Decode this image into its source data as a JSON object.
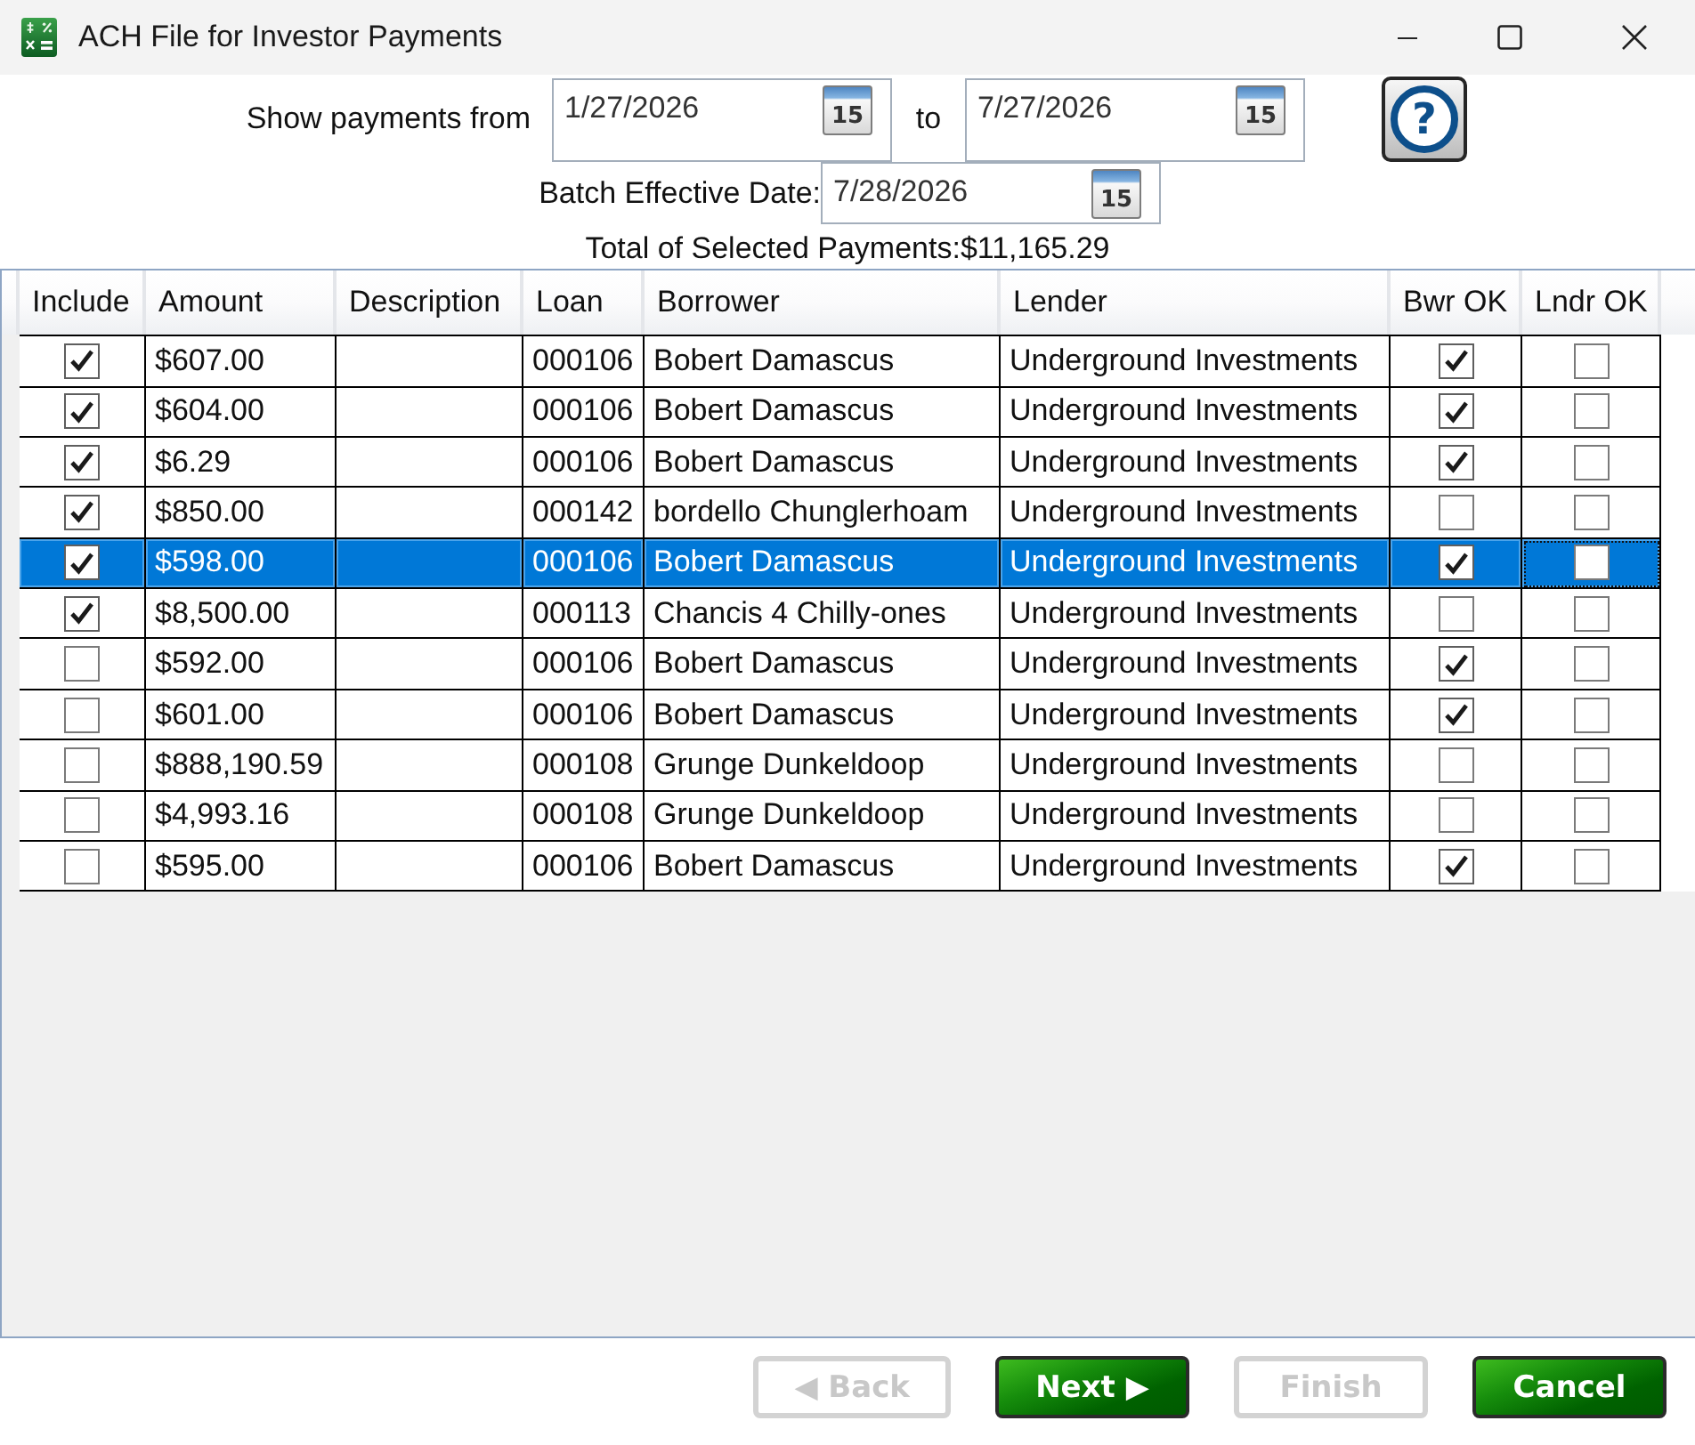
{
  "window": {
    "title": "ACH File for Investor Payments"
  },
  "filters": {
    "from_label": "Show payments from",
    "from_date": "1/27/2026",
    "from_calendar": "15",
    "to_label": "to",
    "to_date": "7/27/2026",
    "to_calendar": "15",
    "batch_label": "Batch Effective Date:",
    "batch_date": "7/28/2026",
    "batch_calendar": "15"
  },
  "help_button": {
    "label": "?"
  },
  "total": "Total of Selected Payments:$11,165.29",
  "table": {
    "columns": [
      {
        "label": "Include",
        "kind": "check"
      },
      {
        "label": "Amount",
        "kind": "text"
      },
      {
        "label": "Description",
        "kind": "text"
      },
      {
        "label": "Loan",
        "kind": "text"
      },
      {
        "label": "Borrower",
        "kind": "text"
      },
      {
        "label": "Lender",
        "kind": "text"
      },
      {
        "label": "Bwr OK",
        "kind": "check"
      },
      {
        "label": "Lndr OK",
        "kind": "check"
      }
    ],
    "rows": [
      {
        "include": true,
        "amount": "$607.00",
        "loan": "000106",
        "borrower": "Bobert Damascus",
        "lender": "Underground Investments",
        "bwr_ok": true,
        "lndr_ok": false,
        "selected": false,
        "focused": false
      },
      {
        "include": true,
        "amount": "$604.00",
        "loan": "000106",
        "borrower": "Bobert Damascus",
        "lender": "Underground Investments",
        "bwr_ok": true,
        "lndr_ok": false,
        "selected": false,
        "focused": false
      },
      {
        "include": true,
        "amount": "$6.29",
        "loan": "000106",
        "borrower": "Bobert Damascus",
        "lender": "Underground Investments",
        "bwr_ok": true,
        "lndr_ok": false,
        "selected": false,
        "focused": false
      },
      {
        "include": true,
        "amount": "$850.00",
        "loan": "000142",
        "borrower": "bordello Chunglerhoam",
        "lender": "Underground Investments",
        "bwr_ok": false,
        "lndr_ok": false,
        "selected": false,
        "focused": false
      },
      {
        "include": true,
        "amount": "$598.00",
        "loan": "000106",
        "borrower": "Bobert Damascus",
        "lender": "Underground Investments",
        "bwr_ok": true,
        "lndr_ok": false,
        "selected": true,
        "focused": true
      },
      {
        "include": true,
        "amount": "$8,500.00",
        "loan": "000113",
        "borrower": "Chancis 4 Chilly-ones",
        "lender": "Underground Investments",
        "bwr_ok": false,
        "lndr_ok": false,
        "selected": false,
        "focused": false
      },
      {
        "include": false,
        "amount": "$592.00",
        "loan": "000106",
        "borrower": "Bobert Damascus",
        "lender": "Underground Investments",
        "bwr_ok": true,
        "lndr_ok": false,
        "selected": false,
        "focused": false
      },
      {
        "include": false,
        "amount": "$601.00",
        "loan": "000106",
        "borrower": "Bobert Damascus",
        "lender": "Underground Investments",
        "bwr_ok": true,
        "lndr_ok": false,
        "selected": false,
        "focused": false
      },
      {
        "include": false,
        "amount": "$888,190.59",
        "loan": "000108",
        "borrower": "Grunge Dunkeldoop",
        "lender": "Underground Investments",
        "bwr_ok": false,
        "lndr_ok": false,
        "selected": false,
        "focused": false
      },
      {
        "include": false,
        "amount": "$4,993.16",
        "loan": "000108",
        "borrower": "Grunge Dunkeldoop",
        "lender": "Underground Investments",
        "bwr_ok": false,
        "lndr_ok": false,
        "selected": false,
        "focused": false
      },
      {
        "include": false,
        "amount": "$595.00",
        "loan": "000106",
        "borrower": "Bobert Damascus",
        "lender": "Underground Investments",
        "bwr_ok": true,
        "lndr_ok": false,
        "selected": false,
        "focused": false
      }
    ]
  },
  "buttons": [
    {
      "label": "◀ Back",
      "disabled": true
    },
    {
      "label": "Next ▶",
      "disabled": false
    },
    {
      "label": "Finish",
      "disabled": true
    },
    {
      "label": "Cancel",
      "disabled": false
    }
  ]
}
